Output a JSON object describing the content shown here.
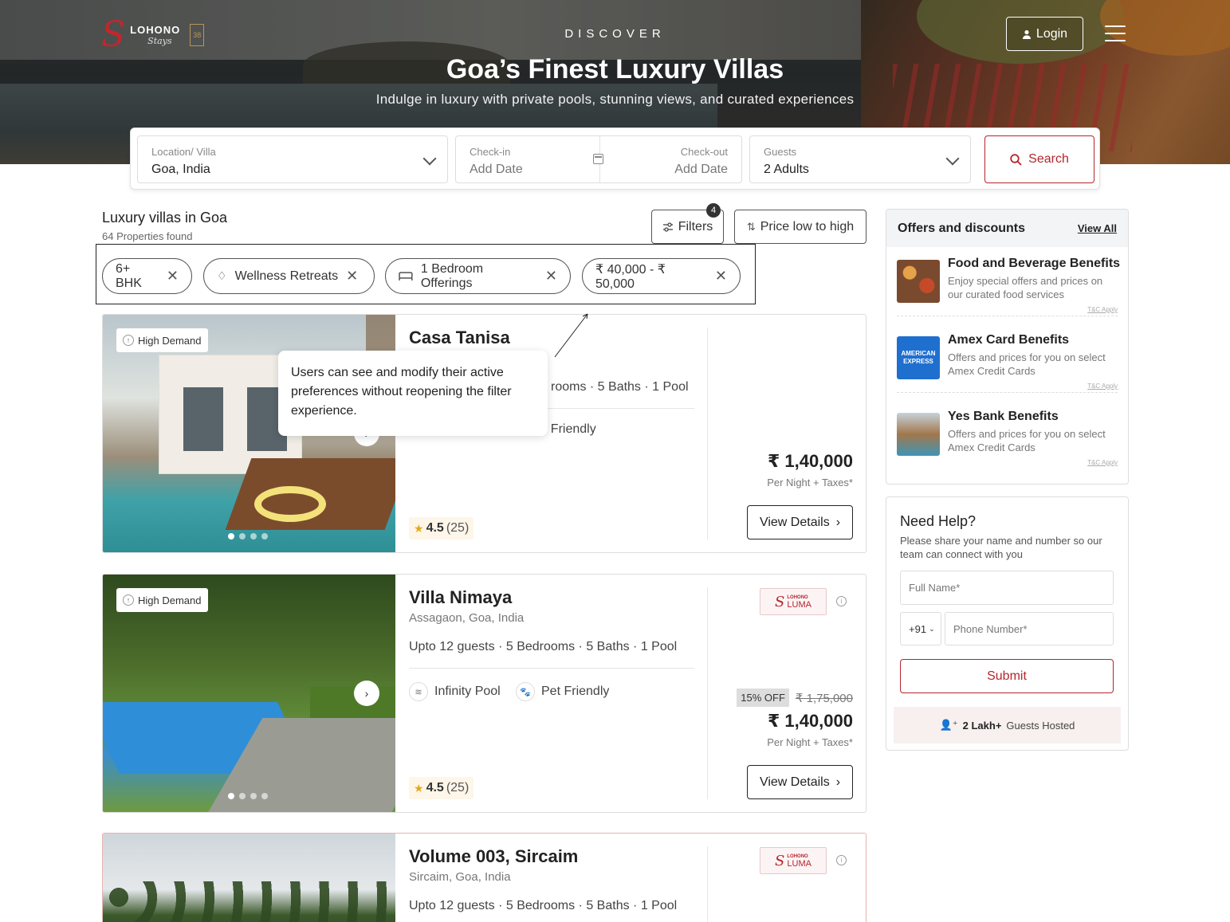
{
  "brand": {
    "name": "LOHONO",
    "sub": "Stays",
    "badge": "38"
  },
  "hero": {
    "eyebrow": "DISCOVER",
    "title": "Goa’s Finest Luxury Villas",
    "subtitle": "Indulge in luxury with private pools, stunning views, and curated experiences"
  },
  "header": {
    "login_label": "Login",
    "menu_icon": "hamburger-menu-icon"
  },
  "search": {
    "location_label": "Location/ Villa",
    "location_value": "Goa, India",
    "checkin_label": "Check-in",
    "checkin_value": "Add Date",
    "checkout_label": "Check-out",
    "checkout_value": "Add Date",
    "guests_label": "Guests",
    "guests_value": "2 Adults",
    "search_label": "Search"
  },
  "listing": {
    "title": "Luxury villas in Goa",
    "count": "64 Properties found",
    "filters_label": "Filters",
    "filters_count": "4",
    "sort_label": "Price low to high",
    "chips": [
      {
        "label": "6+ BHK"
      },
      {
        "label": "Wellness Retreats"
      },
      {
        "label": "1 Bedroom Offerings"
      },
      {
        "label": "₹ 40,000 - ₹ 50,000"
      }
    ]
  },
  "tooltip": {
    "text": "Users can see and modify their active preferences without reopening the filter experience."
  },
  "villas": [
    {
      "badge": "High Demand",
      "name": "Casa Tanisa",
      "spec_visible": "rooms",
      "spec": [
        "5 Baths",
        "1 Pool"
      ],
      "amenity_2_visible": "et Friendly",
      "price": "₹ 1,40,000",
      "taxes": "Per Night + Taxes*",
      "rating": "4.5",
      "reviews": "(25)",
      "cta": "View Details"
    },
    {
      "badge": "High Demand",
      "name": "Villa Nimaya",
      "location": "Assagaon, Goa, India",
      "spec": [
        "Upto 12 guests",
        "5 Bedrooms",
        "5 Baths",
        "1 Pool"
      ],
      "amenities": [
        "Infinity Pool",
        "Pet Friendly"
      ],
      "brand_tag": "LUMA",
      "brand_tag_top": "LOHONO",
      "discount": "15% OFF",
      "original_price": "₹ 1,75,000",
      "price": "₹ 1,40,000",
      "taxes": "Per Night + Taxes*",
      "rating": "4.5",
      "reviews": "(25)",
      "cta": "View Details"
    },
    {
      "name": "Volume 003, Sircaim",
      "location": "Sircaim, Goa, India",
      "spec": [
        "Upto 12 guests",
        "5 Bedrooms",
        "5 Baths",
        "1 Pool"
      ],
      "brand_tag": "LUMA",
      "brand_tag_top": "LOHONO"
    }
  ],
  "offers": {
    "title": "Offers and discounts",
    "view_all": "View All",
    "items": [
      {
        "title": "Food and Beverage Benefits",
        "desc": "Enjoy special offers and prices on our curated food services",
        "tc": "T&C Apply"
      },
      {
        "title": "Amex Card Benefits",
        "desc": "Offers and prices for you on select Amex Credit Cards",
        "tc": "T&C Apply",
        "logo_text": "AMERICAN EXPRESS"
      },
      {
        "title": "Yes Bank Benefits",
        "desc": "Offers and prices for you on select Amex Credit Cards",
        "tc": "T&C Apply"
      }
    ]
  },
  "help": {
    "title": "Need Help?",
    "subtitle": "Please share your name and number so our team can connect with you",
    "name_placeholder": "Full Name*",
    "country_code": "+91",
    "phone_placeholder": "Phone Number*",
    "submit_label": "Submit",
    "guests_hosted_bold": "2 Lakh+",
    "guests_hosted_text": "Guests Hosted"
  },
  "colors": {
    "brand_red": "#b3262d",
    "text_dark": "#222222",
    "star": "#e5a81b"
  }
}
